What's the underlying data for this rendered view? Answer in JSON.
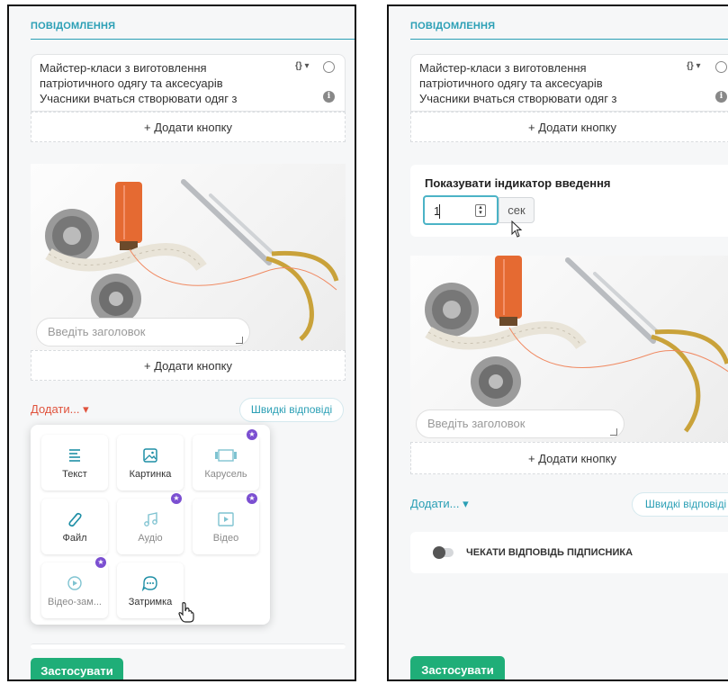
{
  "section_title": "ПОВІДОМЛЕННЯ",
  "message": {
    "line1": "Майстер-класи з виготовлення",
    "line2": "патріотичного одягу та аксесуарів",
    "line3": "Учасники вчаться створювати одяг з",
    "variables_label": "{} ▾"
  },
  "add_button_label": "+ Додати кнопку",
  "image_title_placeholder": "Введіть заголовок",
  "add_menu_label": "Додати... ▾",
  "quick_replies_label": "Швидкі відповіді",
  "quick_replies_label_right": "Швидкі відповіді",
  "menu_items": [
    {
      "label": "Текст",
      "icon": "text-icon",
      "premium": false
    },
    {
      "label": "Картинка",
      "icon": "image-icon",
      "premium": false
    },
    {
      "label": "Карусель",
      "icon": "carousel-icon",
      "premium": true
    },
    {
      "label": "Файл",
      "icon": "paperclip-icon",
      "premium": false
    },
    {
      "label": "Аудіо",
      "icon": "music-icon",
      "premium": true
    },
    {
      "label": "Відео",
      "icon": "video-icon",
      "premium": true
    },
    {
      "label": "Відео-зам...",
      "icon": "video-note-icon",
      "premium": true
    },
    {
      "label": "Затримка",
      "icon": "delay-icon",
      "premium": false
    }
  ],
  "apply_label": "Застосувати",
  "typing": {
    "title": "Показувати індикатор введення",
    "value": "1",
    "unit": "сек"
  },
  "wait_reply_label": "ЧЕКАТИ ВІДПОВІДЬ ПІДПИСНИКА",
  "colors": {
    "accent": "#2a9fb5",
    "apply": "#1fae78",
    "premium": "#7b4fd1",
    "add_menu_active": "#e0533d"
  }
}
